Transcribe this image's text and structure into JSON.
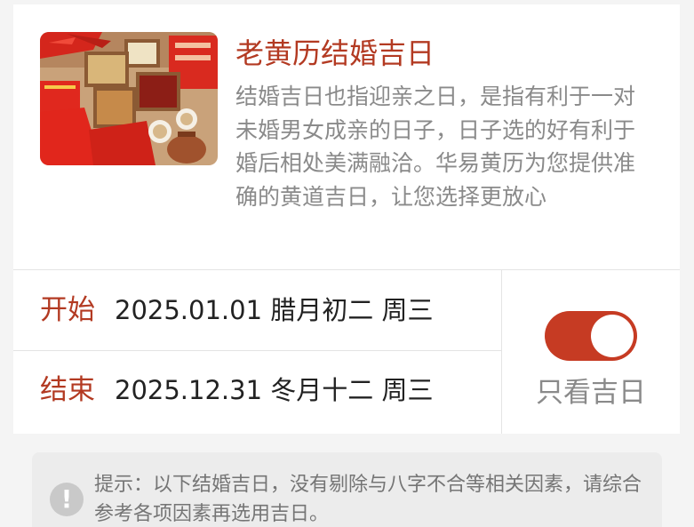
{
  "intro": {
    "title": "老黄历结婚吉日",
    "description": "结婚吉日也指迎亲之日，是指有利于一对未婚男女成亲的日子，日子选的好有利于婚后相处美满融洽。华易黄历为您提供准确的黄道吉日，让您选择更放心"
  },
  "range": {
    "start_label": "开始",
    "start_value": "2025.01.01 腊月初二 周三",
    "end_label": "结束",
    "end_value": "2025.12.31 冬月十二 周三"
  },
  "filter": {
    "toggle_on": true,
    "label": "只看吉日"
  },
  "tip": {
    "icon": "exclamation-icon",
    "text": "提示：以下结婚吉日，没有剔除与八字不合等相关因素，请综合参考各项因素再选用吉日。"
  },
  "colors": {
    "accent": "#b33a22",
    "toggle": "#c63b23",
    "muted_text": "#8a8a8a",
    "background": "#f4f4f4"
  }
}
